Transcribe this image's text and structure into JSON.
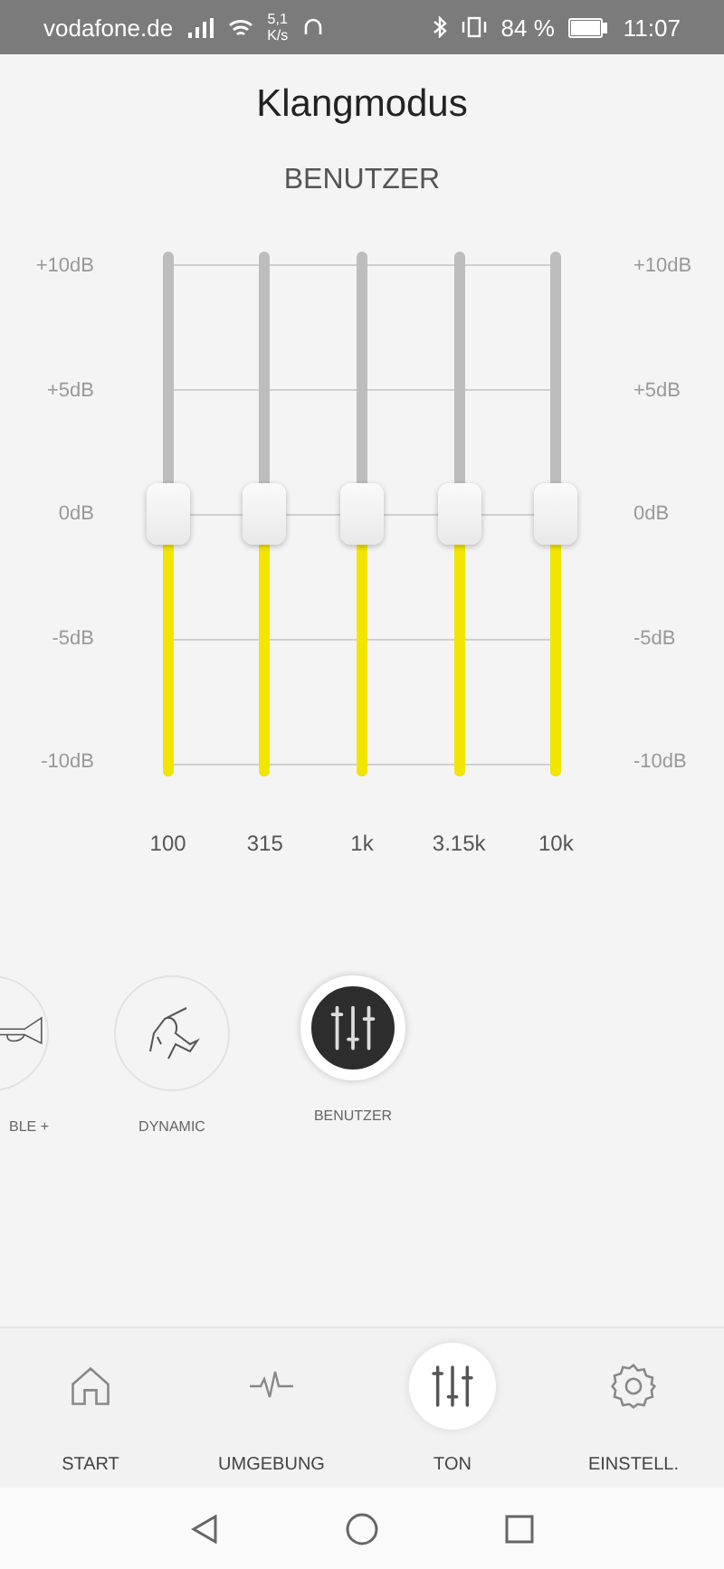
{
  "status_bar": {
    "carrier": "vodafone.de",
    "speed_value": "5,1",
    "speed_unit": "K/s",
    "battery": "84 %",
    "time": "11:07"
  },
  "title": "Klangmodus",
  "subtitle": "BENUTZER",
  "equalizer": {
    "db_labels": [
      "+10dB",
      "+5dB",
      "0dB",
      "-5dB",
      "-10dB"
    ],
    "db_labels_right": [
      "+10dB",
      "+5dB",
      "0dB",
      "-5dB",
      "-10dB"
    ],
    "bands": [
      {
        "freq": "100",
        "level": 0.5
      },
      {
        "freq": "315",
        "level": 0.5
      },
      {
        "freq": "1k",
        "level": 0.5
      },
      {
        "freq": "3.15k",
        "level": 0.5
      },
      {
        "freq": "10k",
        "level": 0.5
      }
    ]
  },
  "modes": [
    {
      "kind": "trumpet",
      "label": "BLE +",
      "selected": false
    },
    {
      "kind": "dynamic",
      "label": "DYNAMIC",
      "selected": false
    },
    {
      "kind": "equalizer",
      "label": "BENUTZER",
      "selected": true
    }
  ],
  "nav": [
    {
      "kind": "home",
      "label": "START",
      "selected": false
    },
    {
      "kind": "pulse",
      "label": "UMGEBUNG",
      "selected": false
    },
    {
      "kind": "equalizer",
      "label": "TON",
      "selected": true
    },
    {
      "kind": "gear",
      "label": "EINSTELL.",
      "selected": false
    }
  ]
}
